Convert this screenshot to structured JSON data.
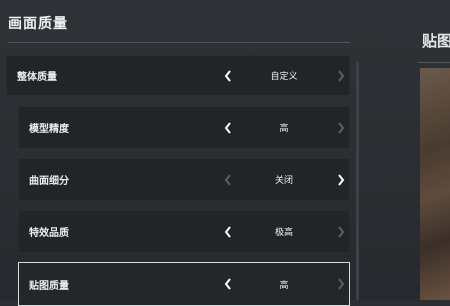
{
  "section": {
    "title": "画面质量"
  },
  "rows": [
    {
      "label": "整体质量",
      "value": "自定义",
      "left_enabled": true,
      "right_enabled": false
    },
    {
      "label": "模型精度",
      "value": "高",
      "left_enabled": true,
      "right_enabled": false
    },
    {
      "label": "曲面细分",
      "value": "关闭",
      "left_enabled": false,
      "right_enabled": true
    },
    {
      "label": "特效品质",
      "value": "极高",
      "left_enabled": true,
      "right_enabled": false
    },
    {
      "label": "贴图质量",
      "value": "高",
      "left_enabled": true,
      "right_enabled": false,
      "selected": true
    }
  ],
  "right_panel": {
    "title": "贴图"
  },
  "colors": {
    "enabled_arrow": "#ffffff",
    "disabled_arrow": "#5a5f65",
    "selected_border": "#d8dadc"
  },
  "icons": {
    "prev": "chevron-left-icon",
    "next": "chevron-right-icon"
  }
}
